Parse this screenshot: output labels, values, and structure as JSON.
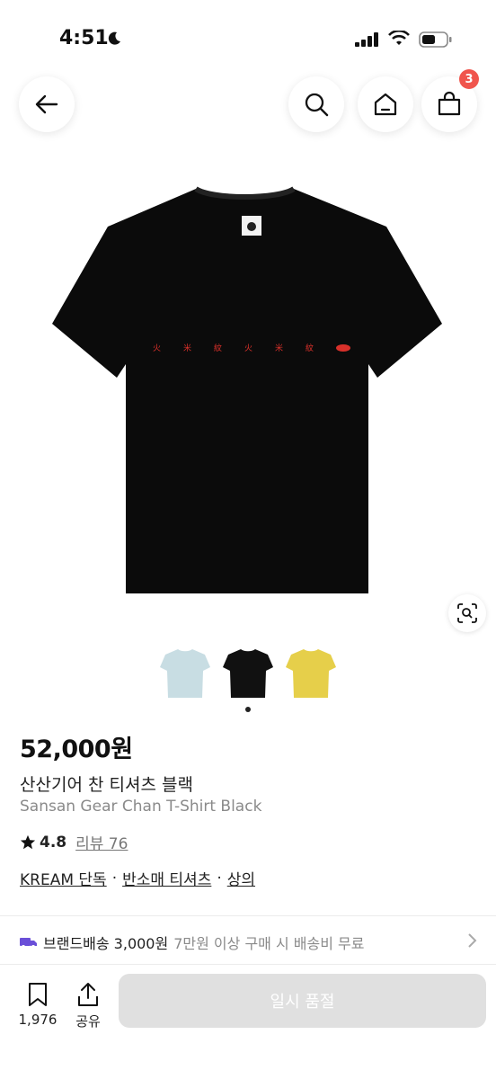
{
  "status_bar": {
    "time": "4:51"
  },
  "nav": {
    "cart_count": "3"
  },
  "product": {
    "price": "52,000원",
    "name_ko": "산산기어 찬 티셔츠 블랙",
    "name_en": "Sansan Gear Chan T-Shirt Black",
    "rating": "4.8",
    "review_label": "리뷰 76",
    "tags": [
      "KREAM 단독",
      "반소매 티셔츠",
      "상의"
    ],
    "tag_separator": "·",
    "print_marks": [
      "火",
      "米",
      "紋",
      "火",
      "米",
      "紋"
    ]
  },
  "thumbnails": [
    {
      "name": "light-blue",
      "color": "#c8dde3"
    },
    {
      "name": "black",
      "color": "#111111"
    },
    {
      "name": "yellow",
      "color": "#e6cf4a"
    }
  ],
  "shipping": {
    "label": "브랜드배송 3,000원",
    "note": "7만원 이상 구매 시 배송비 무료",
    "icon_color": "#6a4fd8"
  },
  "bottom_bar": {
    "bookmark_count": "1,976",
    "share_label": "공유",
    "cta_label": "일시 품절"
  }
}
